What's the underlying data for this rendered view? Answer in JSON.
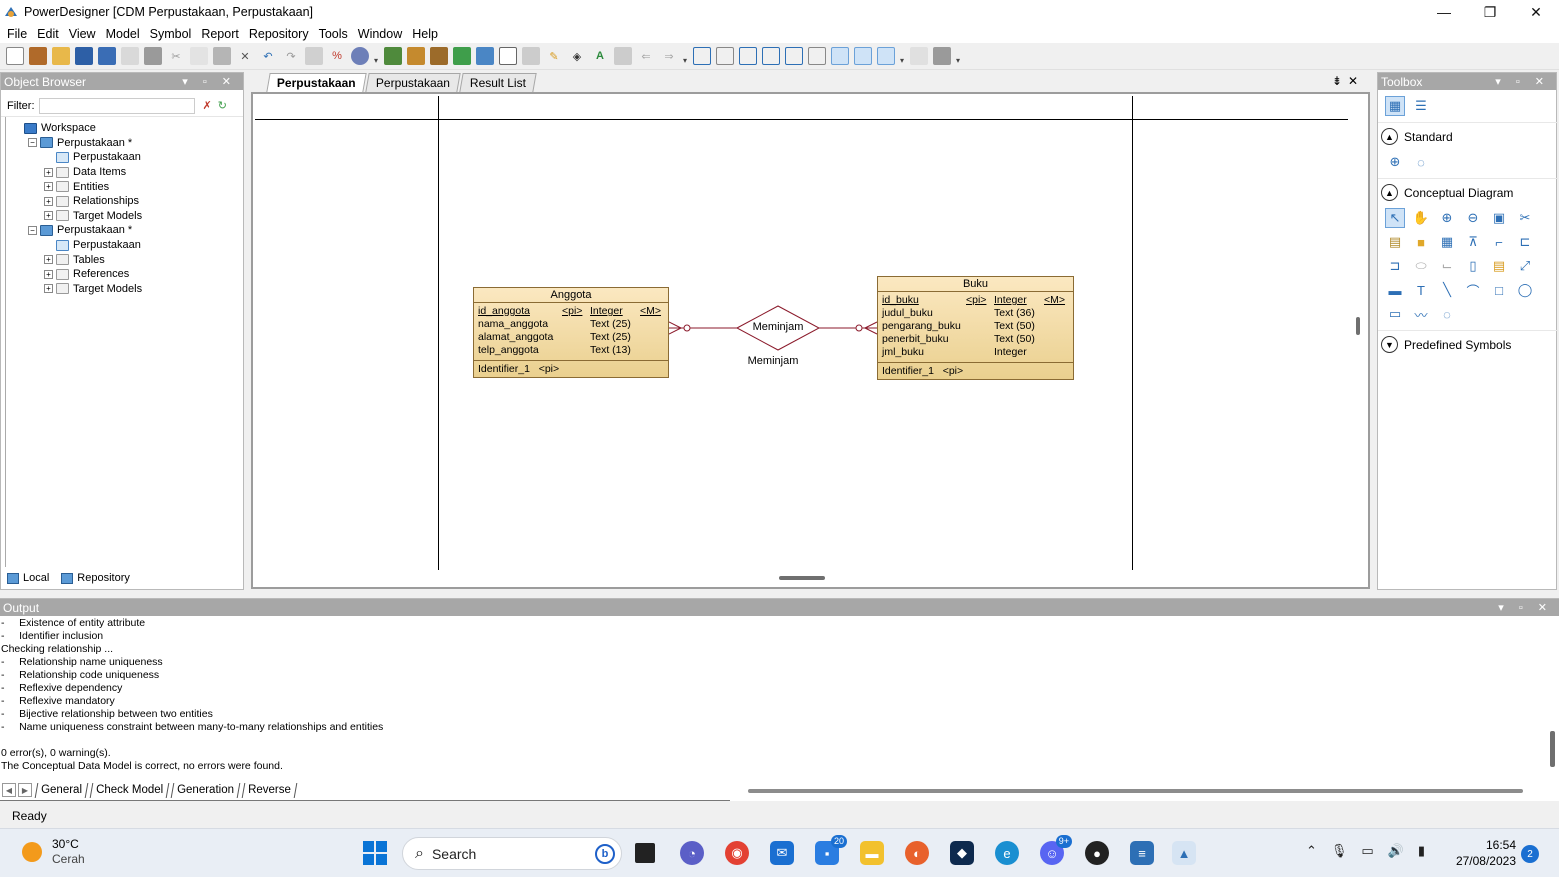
{
  "window": {
    "title": "PowerDesigner [CDM Perpustakaan, Perpustakaan]",
    "controls": {
      "minimize": "—",
      "maximize": "❐",
      "close": "✕"
    }
  },
  "menu": [
    "File",
    "Edit",
    "View",
    "Model",
    "Symbol",
    "Report",
    "Repository",
    "Tools",
    "Window",
    "Help"
  ],
  "object_browser": {
    "title": "Object Browser",
    "filter_label": "Filter:",
    "tree": [
      {
        "label": "Workspace",
        "indent": 0,
        "toggle": "",
        "icon": "ws"
      },
      {
        "label": "Perpustakaan *",
        "indent": 1,
        "toggle": "−",
        "icon": "model"
      },
      {
        "label": "Perpustakaan",
        "indent": 2,
        "toggle": "",
        "icon": "diagram"
      },
      {
        "label": "Data Items",
        "indent": 2,
        "toggle": "+",
        "icon": "folder"
      },
      {
        "label": "Entities",
        "indent": 2,
        "toggle": "+",
        "icon": "folder"
      },
      {
        "label": "Relationships",
        "indent": 2,
        "toggle": "+",
        "icon": "folder"
      },
      {
        "label": "Target Models",
        "indent": 2,
        "toggle": "+",
        "icon": "folder"
      },
      {
        "label": "Perpustakaan *",
        "indent": 1,
        "toggle": "−",
        "icon": "model"
      },
      {
        "label": "Perpustakaan",
        "indent": 2,
        "toggle": "",
        "icon": "diagram"
      },
      {
        "label": "Tables",
        "indent": 2,
        "toggle": "+",
        "icon": "folder"
      },
      {
        "label": "References",
        "indent": 2,
        "toggle": "+",
        "icon": "folder"
      },
      {
        "label": "Target Models",
        "indent": 2,
        "toggle": "+",
        "icon": "folder"
      }
    ],
    "tabs": [
      "Local",
      "Repository"
    ]
  },
  "document_tabs": [
    {
      "label": "Perpustakaan",
      "active": true
    },
    {
      "label": "Perpustakaan",
      "active": false
    },
    {
      "label": "Result List",
      "active": false
    }
  ],
  "diagram": {
    "entities": [
      {
        "name": "Anggota",
        "attributes": [
          {
            "name": "id_anggota",
            "pi": "<pi>",
            "type": "Integer",
            "m": "<M>",
            "key": true
          },
          {
            "name": "nama_anggota",
            "pi": "",
            "type": "Text (25)",
            "m": "",
            "key": false
          },
          {
            "name": "alamat_anggota",
            "pi": "",
            "type": "Text (25)",
            "m": "",
            "key": false
          },
          {
            "name": "telp_anggota",
            "pi": "",
            "type": "Text (13)",
            "m": "",
            "key": false
          }
        ],
        "identifier": "Identifier_1   <pi>"
      },
      {
        "name": "Buku",
        "attributes": [
          {
            "name": "id_buku",
            "pi": "<pi>",
            "type": "Integer",
            "m": "<M>",
            "key": true
          },
          {
            "name": "judul_buku",
            "pi": "",
            "type": "Text (36)",
            "m": "",
            "key": false
          },
          {
            "name": "pengarang_buku",
            "pi": "",
            "type": "Text (50)",
            "m": "",
            "key": false
          },
          {
            "name": "penerbit_buku",
            "pi": "",
            "type": "Text (50)",
            "m": "",
            "key": false
          },
          {
            "name": "jml_buku",
            "pi": "",
            "type": "Integer",
            "m": "",
            "key": false
          }
        ],
        "identifier": "Identifier_1   <pi>"
      }
    ],
    "relationship": {
      "name": "Meminjam",
      "label": "Meminjam"
    }
  },
  "toolbox": {
    "title": "Toolbox",
    "sections": [
      "Standard",
      "Conceptual Diagram",
      "Predefined Symbols"
    ]
  },
  "output": {
    "title": "Output",
    "lines": [
      "-     Existence of entity attribute",
      "-     Identifier inclusion",
      "Checking relationship ...",
      "-     Relationship name uniqueness",
      "-     Relationship code uniqueness",
      "-     Reflexive dependency",
      "-     Reflexive mandatory",
      "-     Bijective relationship between two entities",
      "-     Name uniqueness constraint between many-to-many relationships and entities",
      "",
      "0 error(s), 0 warning(s).",
      "The Conceptual Data Model is correct, no errors were found."
    ],
    "tabs": [
      {
        "label": "General",
        "active": false
      },
      {
        "label": "Check Model",
        "active": true
      },
      {
        "label": "Generation",
        "active": false
      },
      {
        "label": "Reverse",
        "active": false
      }
    ]
  },
  "status": "Ready",
  "taskbar": {
    "weather_temp": "30°C",
    "weather_desc": "Cerah",
    "search_placeholder": "Search",
    "time": "16:54",
    "date": "27/08/2023",
    "notifications": "2",
    "badges": {
      "store": "20",
      "discord": "9+"
    }
  },
  "colors": {
    "entity_fill_top": "#fbe8c1",
    "entity_fill_bottom": "#ead08f",
    "relationship_stroke": "#8b1a2b",
    "pane_header": "#a7a7a7",
    "accent": "#1a6fd1"
  }
}
